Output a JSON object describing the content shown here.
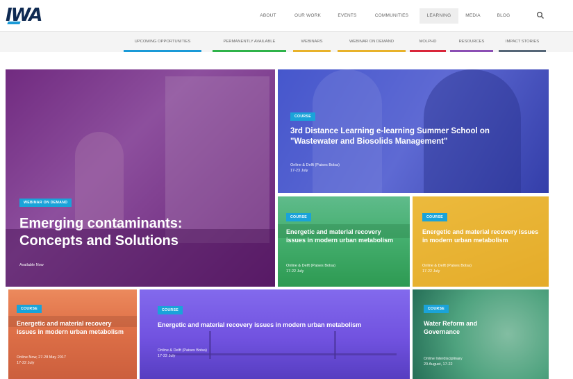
{
  "header": {
    "logo": "IWA",
    "nav": [
      "ABOUT",
      "OUR WORK",
      "EVENTS",
      "COMMUNITIES",
      "LEARNING",
      "MEDIA",
      "BLOG"
    ],
    "active_nav": "LEARNING",
    "search_icon": "search-icon"
  },
  "subnav": [
    {
      "label": "UPCOMING OPPORTUNITIES",
      "color": "#1a9ad7"
    },
    {
      "label": "PERMANENTLY AVAILABLE",
      "color": "#2fb34a"
    },
    {
      "label": "WEBINARS",
      "color": "#e8b22a"
    },
    {
      "label": "WEBINAR ON DEMAND",
      "color": "#e8b22a"
    },
    {
      "label": "MOLPHD",
      "color": "#d9263a"
    },
    {
      "label": "RESOURCES",
      "color": "#8b4fb4"
    },
    {
      "label": "IMPACT STORIES",
      "color": "#556677"
    }
  ],
  "tiles": {
    "main": {
      "badge": "WEBINAR ON DEMAND",
      "title": "Emerging contaminants: Concepts and Solutions",
      "meta": "Available Now",
      "tint": "#6a1f78"
    },
    "summer_school": {
      "badge": "COURSE",
      "title": "3rd Distance Learning e-learning Summer School on \"Wastewater and Biosolids Management\"",
      "meta": [
        "Online & Delft (Paises Bolsa)",
        "17-23 July"
      ],
      "tint": "#3b4ad0"
    },
    "green": {
      "badge": "COURSE",
      "title": "Energetic and material recovery issues in modern urban metabolism",
      "meta": [
        "Online & Delft (Paises Bolsa)",
        "17-22 July"
      ],
      "tint": "#2fa85a"
    },
    "yellow": {
      "badge": "COURSE",
      "title": "Energetic and material recovery issues in modern urban metabolism",
      "meta": [
        "Online & Delft (Paises Bolsa)",
        "17-22 July"
      ],
      "tint": "#e8b22a"
    },
    "orange": {
      "badge": "COURSE",
      "title": "Energetic and material recovery issues in modern urban metabolism",
      "meta": [
        "Online Now, 27-28 May 2017",
        "17-22 July"
      ],
      "tint": "#e8744a"
    },
    "bridge": {
      "badge": "COURSE",
      "title": "Energetic and material recovery issues in modern urban metabolism",
      "meta": [
        "Online & Delft (Paises Bolsa)",
        "17-22 July"
      ],
      "tint": "#7a56e8"
    },
    "teal": {
      "badge": "COURSE",
      "title": "Water Reform and Governance",
      "meta": [
        "Online Interdisciplinary",
        "20 August, 17-22"
      ],
      "tint": "#2f8a6a"
    }
  }
}
